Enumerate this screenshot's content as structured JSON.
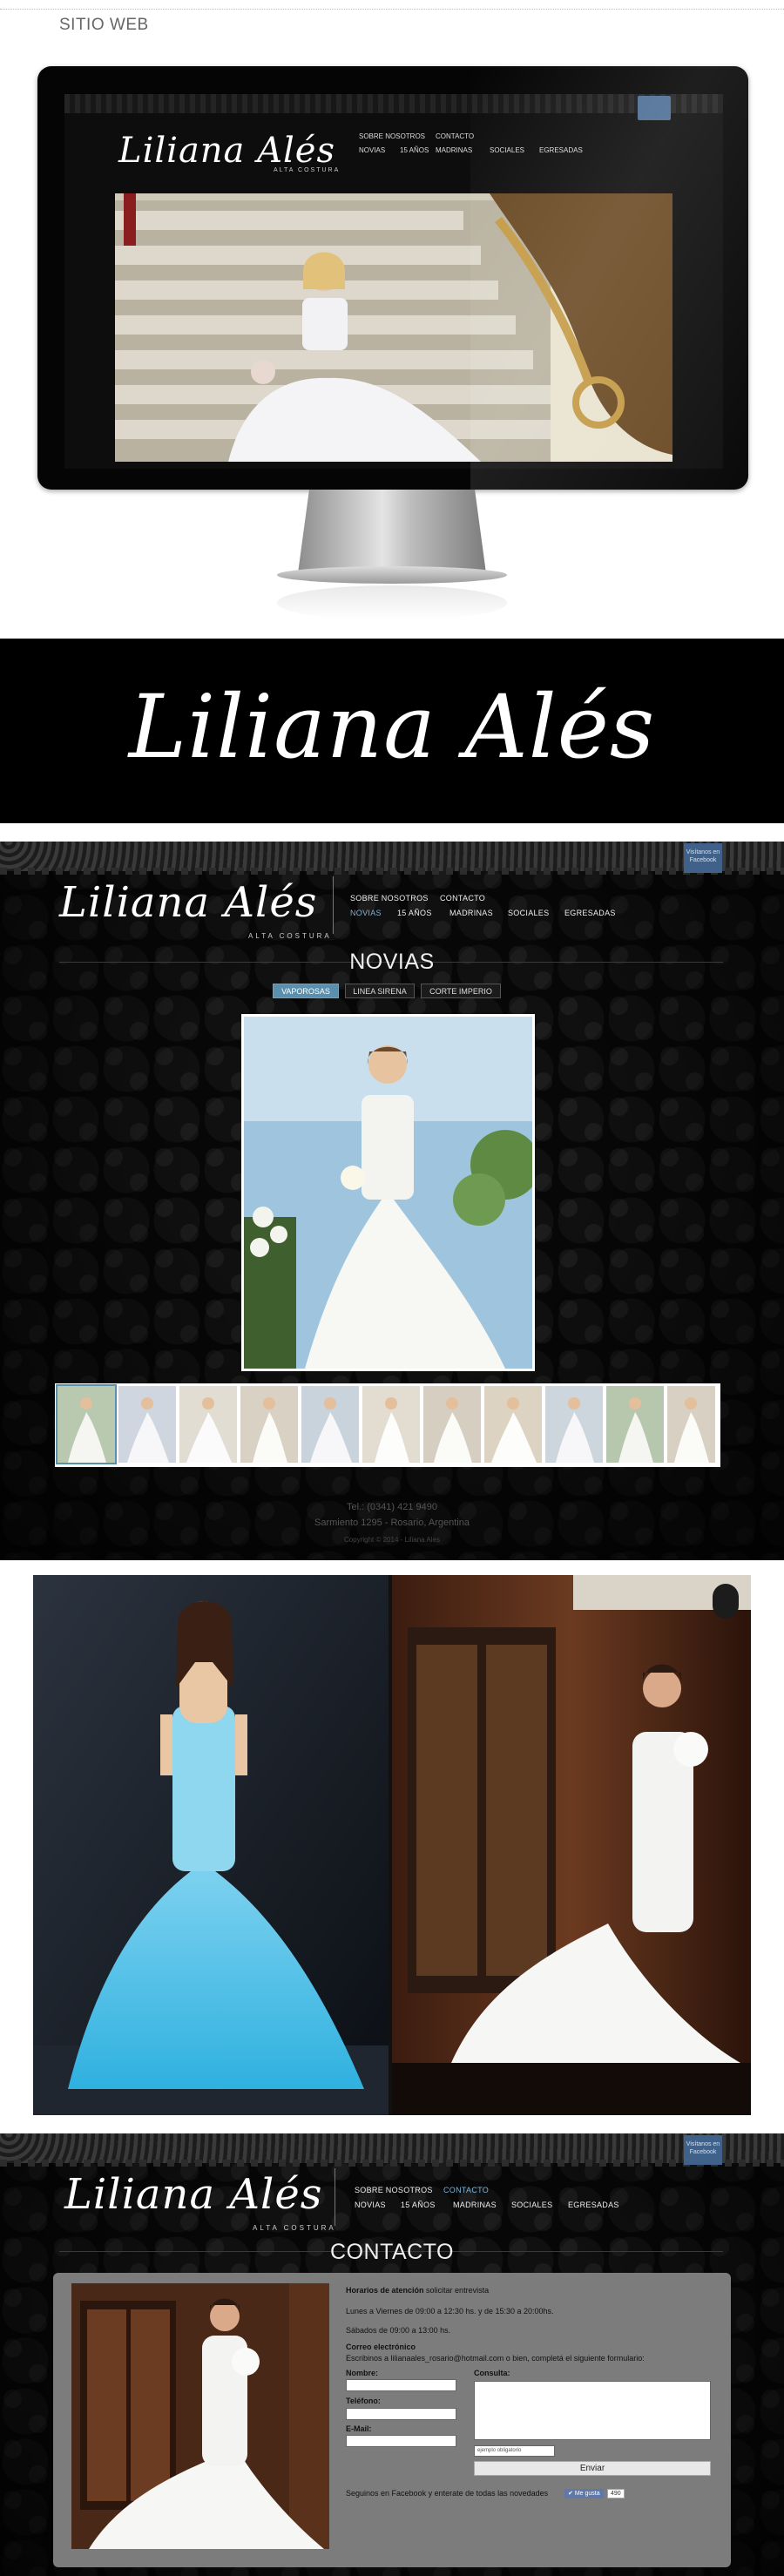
{
  "section_title": "SITIO WEB",
  "brand": {
    "logo": "Liliana Alés",
    "subtitle": "ALTA COSTURA",
    "facebook_tag": "Visítanos en Facebook"
  },
  "nav": {
    "row1": [
      "SOBRE NOSOTROS",
      "CONTACTO"
    ],
    "row2": [
      "NOVIAS",
      "15 AÑOS",
      "MADRINAS",
      "SOCIALES",
      "EGRESADAS"
    ]
  },
  "novias_page": {
    "heading": "NOVIAS",
    "tabs": [
      "VAPOROSAS",
      "LINEA SIRENA",
      "CORTE IMPERIO"
    ],
    "active_tab": "VAPOROSAS",
    "thumbnail_count": 11
  },
  "footer": {
    "phone": "Tel.: (0341) 421 9490",
    "address": "Sarmiento 1295 - Rosario, Argentina",
    "copyright": "Copyright © 2014 - Liliana Ales"
  },
  "contact_page": {
    "heading": "CONTACTO",
    "hours_title": "Horarios de atención",
    "hours_note": "solicitar entrevista",
    "hours_line1": "Lunes a Viernes de 09:00 a 12:30 hs. y de 15:30 a 20:00hs.",
    "hours_line2": "Sábados de 09:00 a 13:00 hs.",
    "email_title": "Correo electrónico",
    "email_line": "Escribinos a lilianaales_rosario@hotmail.com o bien, completá el siguiente formulario:",
    "label_name": "Nombre:",
    "label_phone": "Teléfono:",
    "label_email": "E-Mail:",
    "label_query": "Consulta:",
    "captcha_placeholder": "ejemplo obligatorio",
    "send_label": "Enviar",
    "facebook_line": "Seguinos en Facebook y enterate de todas las novedades",
    "like_label": "Me gusta",
    "like_count": "490"
  },
  "colors": {
    "accent": "#5b8fae",
    "contact_active": "#7fb3d5",
    "facebook": "#40628a"
  }
}
